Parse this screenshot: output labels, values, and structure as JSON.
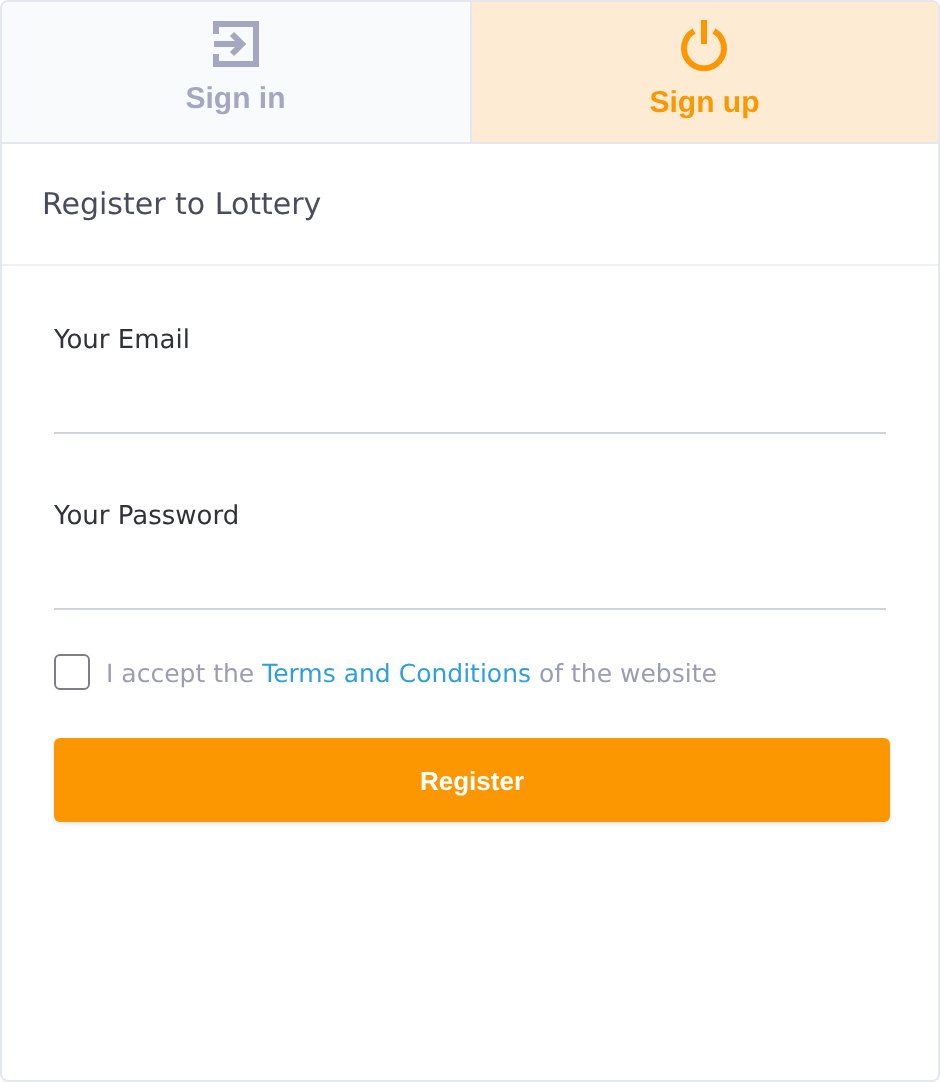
{
  "tabs": [
    {
      "label": "Sign in",
      "kind": "enter",
      "selected": false
    },
    {
      "label": "Sign up",
      "kind": "power",
      "selected": true
    }
  ],
  "title": "Register to Lottery",
  "fields": [
    {
      "label": "Your Email"
    },
    {
      "label": "Your Password"
    }
  ],
  "terms": {
    "checked": false,
    "before": "I accept the",
    "link": "Terms and Conditions",
    "after": "of the website"
  },
  "button": "Register"
}
